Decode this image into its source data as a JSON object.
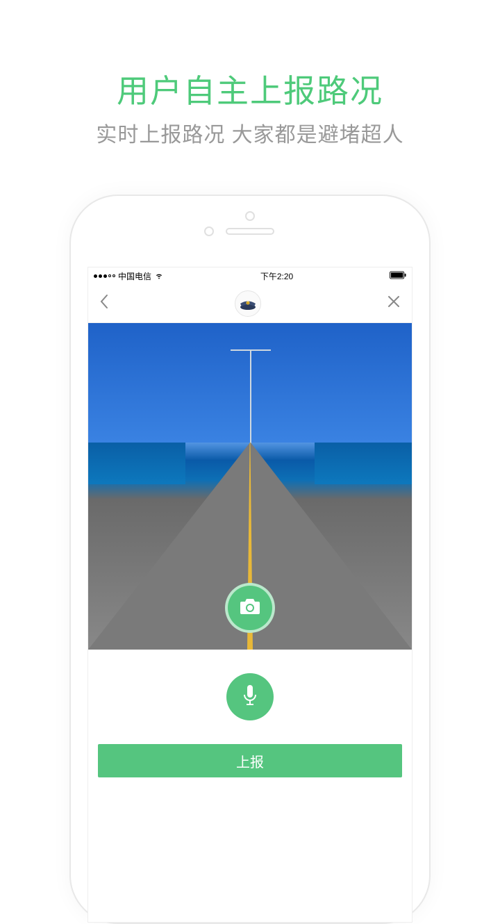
{
  "marketing": {
    "title": "用户自主上报路况",
    "subtitle": "实时上报路况 大家都是避堵超人"
  },
  "status_bar": {
    "carrier": "中国电信",
    "time": "下午2:20"
  },
  "header": {
    "avatar_icon": "police-cap-icon"
  },
  "buttons": {
    "submit_label": "上报"
  },
  "colors": {
    "primary_green": "#55c57f",
    "title_green": "#4eca7a",
    "subtitle_gray": "#999999"
  }
}
